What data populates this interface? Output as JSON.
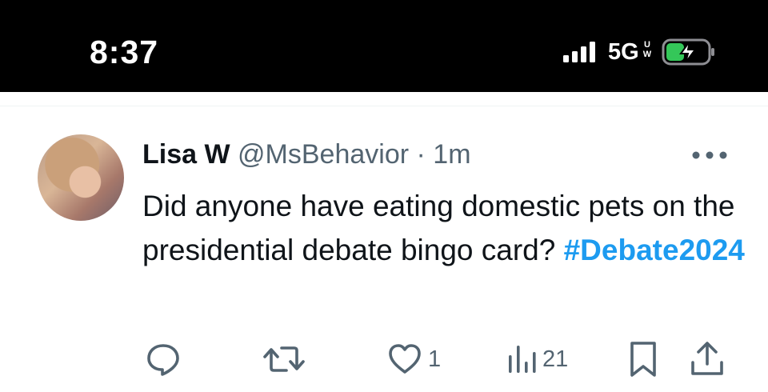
{
  "status_bar": {
    "time": "8:37",
    "network": "5G",
    "network_badge_top": "U",
    "network_badge_bottom": "W",
    "battery_color": "#34c759",
    "icons": [
      "signal-icon",
      "battery-charging-icon"
    ]
  },
  "tweet": {
    "display_name": "Lisa W",
    "handle": "@MsBehavior",
    "separator": "·",
    "time_ago": "1m",
    "text_before": "Did anyone have eating domestic pets on the presidential debate bingo card? ",
    "hashtag": "#Debate2024",
    "hashtag_color": "#1d9bf0"
  },
  "actions": {
    "reply_icon": "reply-icon",
    "retweet_icon": "retweet-icon",
    "like_icon": "heart-icon",
    "like_count": "1",
    "views_icon": "views-icon",
    "views_count": "21",
    "bookmark_icon": "bookmark-icon",
    "share_icon": "share-icon"
  }
}
